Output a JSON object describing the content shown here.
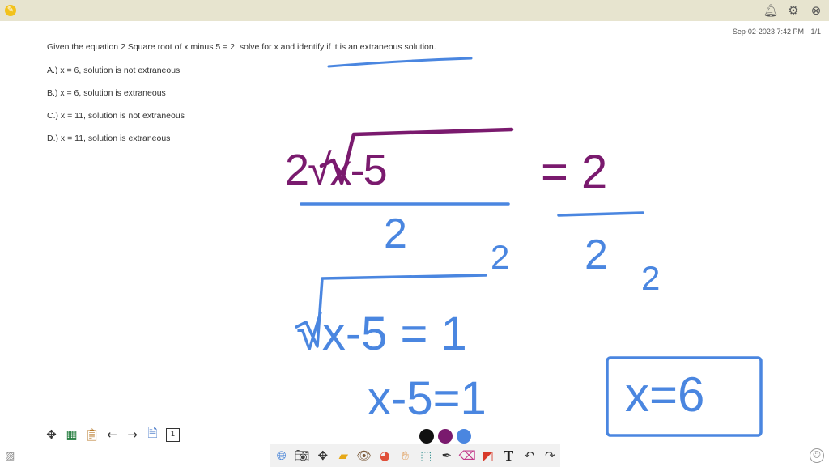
{
  "topbar": {
    "app_icon": "pencil-badge-icon",
    "icons": [
      "bell-icon",
      "gear-icon",
      "close-icon"
    ]
  },
  "document": {
    "timestamp": "Sep-02-2023 7:42 PM",
    "page_indicator": "1/1",
    "question": "Given the equation 2 Square root of x minus 5 = 2, solve for x and identify if it is an extraneous solution.",
    "options": [
      "A.) x = 6, solution is not extraneous",
      "B.) x = 6, solution is extraneous",
      "C.) x = 11, solution is not extraneous",
      "D.) x = 11, solution is extraneous"
    ]
  },
  "handwriting": {
    "line1_left": "2√x-5",
    "line1_right": "= 2",
    "divisor_left": "2",
    "divisor_right": "2",
    "exp_left": "2",
    "exp_right": "2",
    "line2": "√x-5 = 1",
    "line3": "x-5=1",
    "answer": "x=6",
    "ink_colors": {
      "purple": "#7a1a6e",
      "blue": "#4a86e0"
    }
  },
  "page_toolbar": {
    "tools": [
      "move-icon",
      "excel-icon",
      "clipboard-icon",
      "arrow-left-icon",
      "arrow-right-icon",
      "add-page-icon",
      "page-count-icon"
    ],
    "page_count": "1"
  },
  "palette": {
    "colors": [
      "#111111",
      "#7a1a6e",
      "#4a86e0"
    ]
  },
  "drawing_toolbar": {
    "tools": [
      "globe-icon",
      "camera-icon",
      "move-icon",
      "folder-icon",
      "eye-icon",
      "color-wheel-icon",
      "hand-icon",
      "selection-icon",
      "pen-icon",
      "eraser-icon",
      "shape-icon",
      "text-icon",
      "undo-icon",
      "redo-icon"
    ],
    "text_tool_label": "T"
  }
}
